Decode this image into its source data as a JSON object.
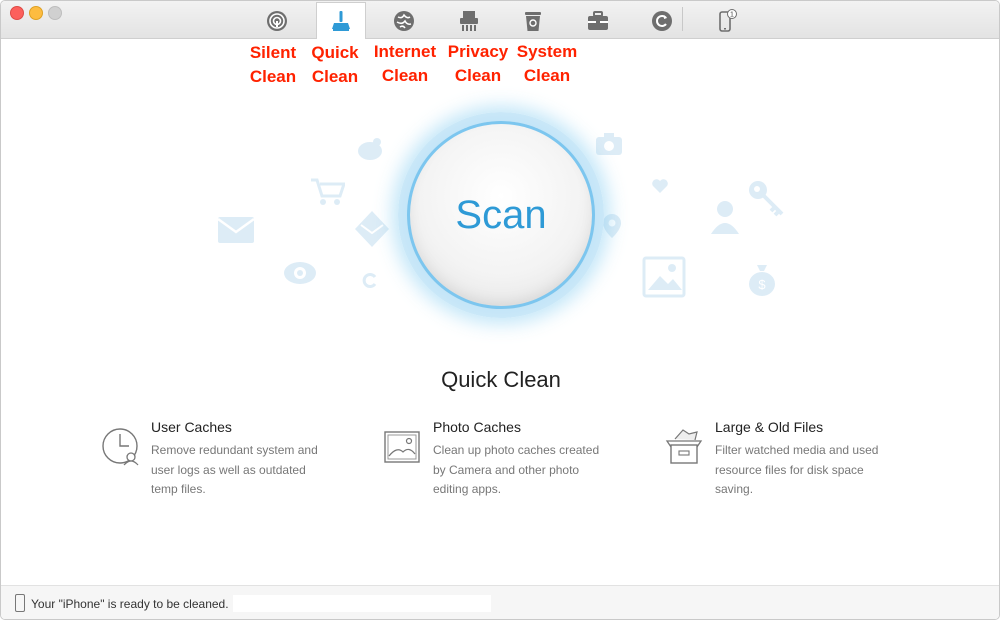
{
  "toolbar": {
    "tabs": [
      {
        "id": "silent-clean",
        "icon": "silent-clean-icon"
      },
      {
        "id": "quick-clean",
        "icon": "quick-clean-broom-icon",
        "active": true
      },
      {
        "id": "internet-clean",
        "icon": "internet-globe-icon"
      },
      {
        "id": "privacy-clean",
        "icon": "privacy-shredder-icon"
      },
      {
        "id": "system-clean",
        "icon": "system-trash-icon"
      },
      {
        "id": "toolbox",
        "icon": "toolbox-briefcase-icon"
      },
      {
        "id": "backup",
        "icon": "backup-refresh-icon"
      },
      {
        "id": "device",
        "icon": "iphone-device-icon",
        "badge": "1"
      }
    ]
  },
  "annotations": {
    "silent": "Silent\nClean",
    "quick": "Quick\nClean",
    "internet": "Internet\nClean",
    "privacy": "Privacy\nClean",
    "system": "System\nClean"
  },
  "scan": {
    "label": "Scan"
  },
  "main": {
    "title": "Quick Clean",
    "features": [
      {
        "title": "User Caches",
        "desc": "Remove redundant system and user logs as well as outdated temp files.",
        "icon": "user-caches-clock-icon"
      },
      {
        "title": "Photo Caches",
        "desc": "Clean up photo caches created by Camera and other photo editing apps.",
        "icon": "photo-caches-picture-icon"
      },
      {
        "title": "Large & Old Files",
        "desc": "Filter watched media and used resource files for disk space saving.",
        "icon": "large-old-files-box-icon"
      }
    ]
  },
  "status": {
    "text": "Your \"iPhone\" is ready to be cleaned."
  },
  "colors": {
    "accent": "#2e9ad6",
    "annotation": "#ff2200",
    "bg_icon": "#d8e9f5"
  }
}
